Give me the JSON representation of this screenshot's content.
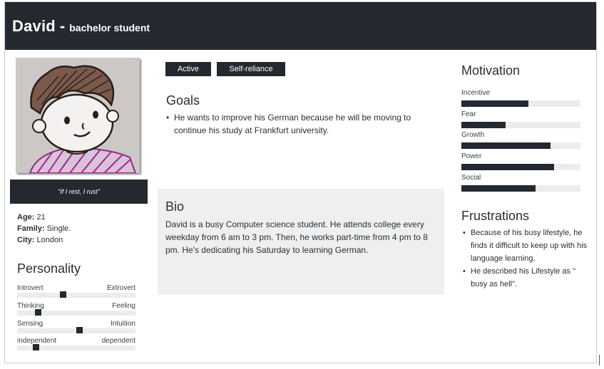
{
  "header": {
    "name": "David",
    "separator": "-",
    "role": "bachelor student"
  },
  "quote": "\"If I rest, I rust\"",
  "facts": [
    {
      "label": "Age:",
      "value": "21"
    },
    {
      "label": "Family:",
      "value": "Single."
    },
    {
      "label": "City:",
      "value": "London"
    }
  ],
  "tags": [
    "Active",
    "Self-reliance"
  ],
  "goals": {
    "title": "Goals",
    "items": [
      "He wants to improve his German because he will be moving to continue his study at Frankfurt university."
    ]
  },
  "bio": {
    "title": "Bio",
    "text": "David is a busy Computer science student. He attends college every weekday from 6 am to 3 pm. Then, he works part-time from 4 pm to 8 pm. He's dedicating his Saturday to learning German."
  },
  "personality": {
    "title": "Personality",
    "traits": [
      {
        "left": "Introvert",
        "right": "Extrovert",
        "position": 0.39
      },
      {
        "left": "Thinking",
        "right": "Feeling",
        "position": 0.18
      },
      {
        "left": "Sensing",
        "right": "Intuition",
        "position": 0.53
      },
      {
        "left": "independent",
        "right": "dependent",
        "position": 0.16
      }
    ]
  },
  "motivation": {
    "title": "Motivation",
    "items": [
      {
        "label": "Incentive",
        "level": 0.56
      },
      {
        "label": "Fear",
        "level": 0.37
      },
      {
        "label": "Growth",
        "level": 0.75
      },
      {
        "label": "Power",
        "level": 0.78
      },
      {
        "label": "Social",
        "level": 0.62
      }
    ]
  },
  "frustrations": {
    "title": "Frustrations",
    "items": [
      "Because of his busy lifestyle, he finds it difficult to keep up with his language learning.",
      "He described his Lifestyle as \" busy as hell\"."
    ]
  },
  "colors": {
    "dark": "#23292e",
    "panel": "#efefef",
    "track": "#ececec"
  },
  "icons": {
    "avatar": "cartoon-boy-drawing"
  }
}
